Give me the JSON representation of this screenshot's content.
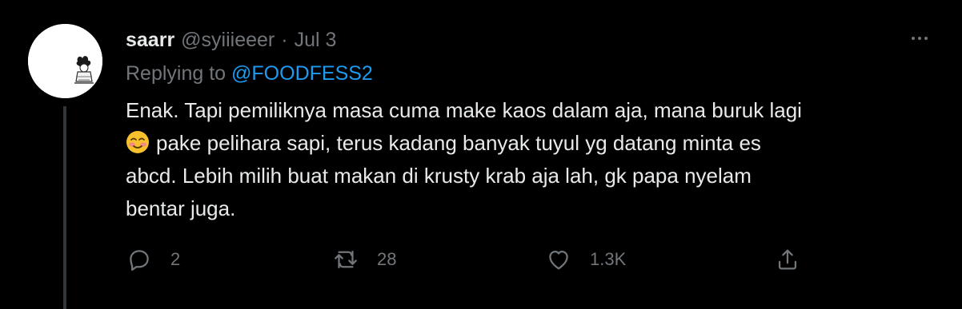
{
  "author": {
    "name": "saarr",
    "handle": "@syiiieeer",
    "separator": "·",
    "date": "Jul 3"
  },
  "reply": {
    "prefix": "Replying to ",
    "mention": "@FOODFESS2"
  },
  "tweet": {
    "line1": "Enak. Tapi pemiliknya masa cuma make kaos dalam aja, mana buruk lagi",
    "line2": "pake pelihara sapi, terus kadang banyak tuyul yg datang minta es",
    "line3": "abcd. Lebih milih buat makan di krusty krab aja lah, gk papa nyelam",
    "line4": "bentar juga.",
    "emoji": "smiling-face-with-smiling-eyes"
  },
  "actions": {
    "replies": "2",
    "retweets": "28",
    "likes": "1.3K"
  },
  "colors": {
    "background": "#000000",
    "text": "#e7e9ea",
    "muted": "#71767b",
    "link": "#1d9bf0"
  }
}
